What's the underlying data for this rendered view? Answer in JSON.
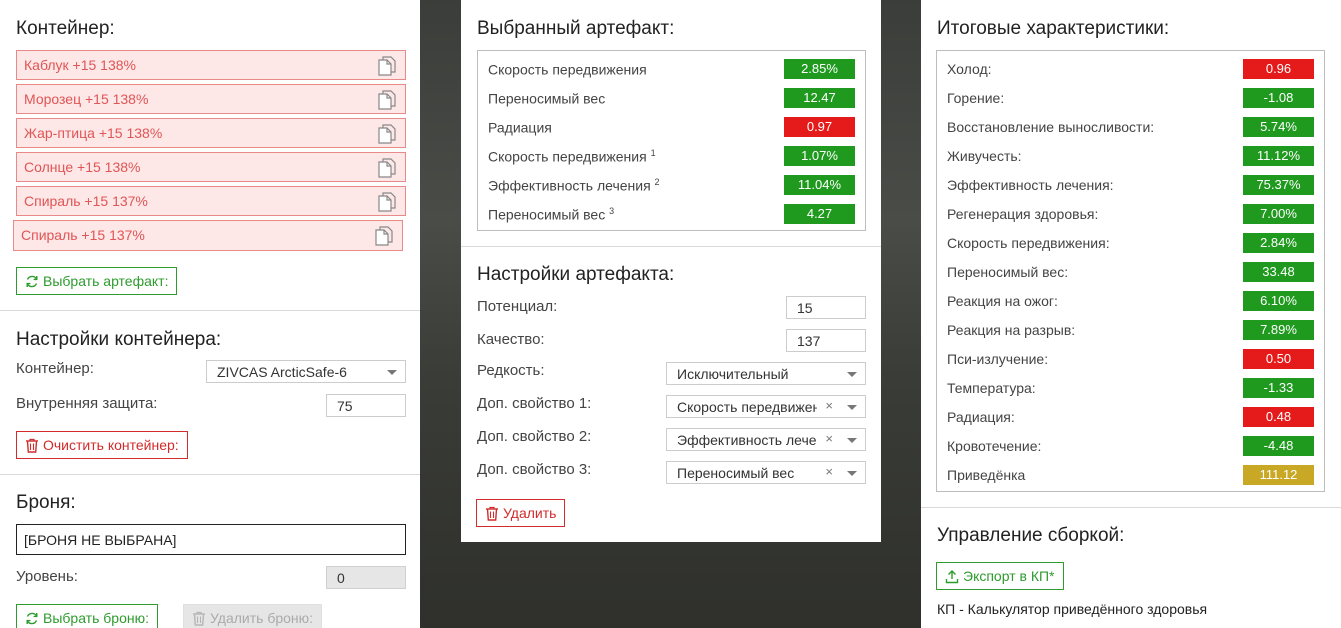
{
  "container": {
    "title": "Контейнер:",
    "items": [
      {
        "label": "Каблук +15 138%"
      },
      {
        "label": "Морозец +15 138%"
      },
      {
        "label": "Жар-птица +15 138%"
      },
      {
        "label": "Солнце +15 138%"
      },
      {
        "label": "Спираль +15 137%"
      },
      {
        "label": "Спираль +15 137%"
      }
    ],
    "select_artifact_label": "Выбрать артефакт:"
  },
  "container_settings": {
    "title": "Настройки контейнера:",
    "container_label": "Контейнер:",
    "container_value": "ZIVCAS ArcticSafe-6",
    "protection_label": "Внутренняя защита:",
    "protection_value": "75",
    "clear_label": "Очистить контейнер:"
  },
  "armor": {
    "title": "Броня:",
    "value": "[БРОНЯ НЕ ВЫБРАНА]",
    "level_label": "Уровень:",
    "level_value": "0",
    "select_label": "Выбрать броню:",
    "delete_label": "Удалить броню:"
  },
  "selected_artifact": {
    "title": "Выбранный артефакт:",
    "stats": [
      {
        "label": "Скорость передвижения",
        "sup": "",
        "value": "2.85%",
        "color": "green"
      },
      {
        "label": "Переносимый вес",
        "sup": "",
        "value": "12.47",
        "color": "green"
      },
      {
        "label": "Радиация",
        "sup": "",
        "value": "0.97",
        "color": "red"
      },
      {
        "label": "Скорость передвижения",
        "sup": "1",
        "value": "1.07%",
        "color": "green"
      },
      {
        "label": "Эффективность лечения",
        "sup": "2",
        "value": "11.04%",
        "color": "green"
      },
      {
        "label": "Переносимый вес",
        "sup": "3",
        "value": "4.27",
        "color": "green"
      }
    ]
  },
  "artifact_settings": {
    "title": "Настройки артефакта:",
    "potential_label": "Потенциал:",
    "potential_value": "15",
    "quality_label": "Качество:",
    "quality_value": "137",
    "rarity_label": "Редкость:",
    "rarity_value": "Исключительный",
    "extra1_label": "Доп. свойство 1:",
    "extra1_value": "Скорость передвижения",
    "extra2_label": "Доп. свойство 2:",
    "extra2_value": "Эффективность лечения",
    "extra3_label": "Доп. свойство 3:",
    "extra3_value": "Переносимый вес",
    "delete_label": "Удалить",
    "clear_glyph": "×"
  },
  "totals": {
    "title": "Итоговые характеристики:",
    "stats": [
      {
        "label": "Холод:",
        "value": "0.96",
        "color": "red"
      },
      {
        "label": "Горение:",
        "value": "-1.08",
        "color": "green"
      },
      {
        "label": "Восстановление выносливости:",
        "value": "5.74%",
        "color": "green"
      },
      {
        "label": "Живучесть:",
        "value": "11.12%",
        "color": "green"
      },
      {
        "label": "Эффективность лечения:",
        "value": "75.37%",
        "color": "green"
      },
      {
        "label": "Регенерация здоровья:",
        "value": "7.00%",
        "color": "green"
      },
      {
        "label": "Скорость передвижения:",
        "value": "2.84%",
        "color": "green"
      },
      {
        "label": "Переносимый вес:",
        "value": "33.48",
        "color": "green"
      },
      {
        "label": "Реакция на ожог:",
        "value": "6.10%",
        "color": "green"
      },
      {
        "label": "Реакция на разрыв:",
        "value": "7.89%",
        "color": "green"
      },
      {
        "label": "Пси-излучение:",
        "value": "0.50",
        "color": "red"
      },
      {
        "label": "Температура:",
        "value": "-1.33",
        "color": "green"
      },
      {
        "label": "Радиация:",
        "value": "0.48",
        "color": "red"
      },
      {
        "label": "Кровотечение:",
        "value": "-4.48",
        "color": "green"
      },
      {
        "label": "Приведёнка",
        "value": "111.12",
        "color": "gold"
      }
    ]
  },
  "build": {
    "title": "Управление сборкой:",
    "export_label": "Экспорт в КП*",
    "note": "КП - Калькулятор приведённого здоровья"
  },
  "colors": {
    "green": "#1f9a1f",
    "red": "#e51b1b",
    "gold": "#c9a825",
    "item_bg": "#fde7e7",
    "item_border": "#e88a8a"
  }
}
